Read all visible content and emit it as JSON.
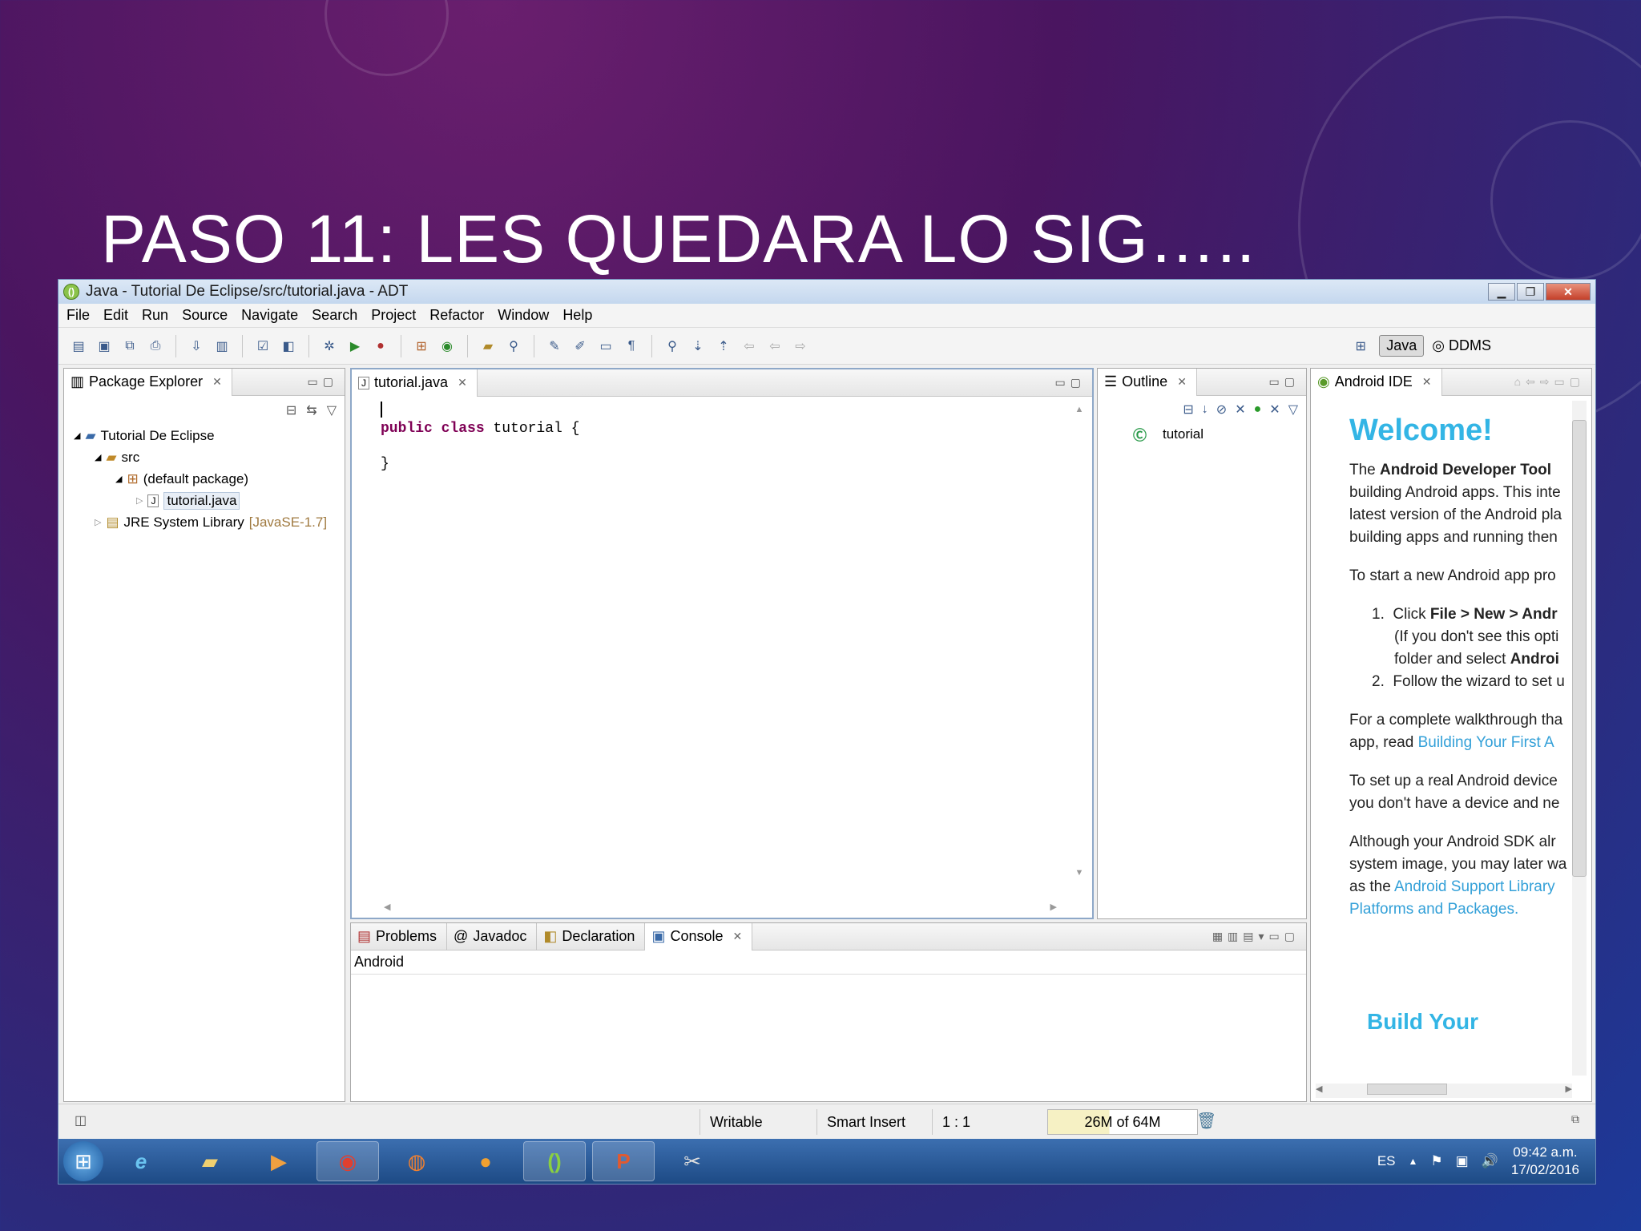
{
  "slide": {
    "title": "PASO 11: LES QUEDARA LO SIG….."
  },
  "window": {
    "title": "Java - Tutorial De Eclipse/src/tutorial.java - ADT",
    "menu": [
      "File",
      "Edit",
      "Run",
      "Source",
      "Navigate",
      "Search",
      "Project",
      "Refactor",
      "Window",
      "Help"
    ],
    "perspectives": {
      "java": "Java",
      "ddms": "DDMS"
    }
  },
  "package_explorer": {
    "tab": "Package Explorer",
    "tree": {
      "project": "Tutorial De Eclipse",
      "src": "src",
      "package": "(default package)",
      "file": "tutorial.java",
      "jre": "JRE System Library",
      "jre_version": "[JavaSE-1.7]"
    }
  },
  "editor": {
    "tab": "tutorial.java",
    "line1_kw": "public class",
    "line1_rest": " tutorial {",
    "line2": "}"
  },
  "outline": {
    "tab": "Outline",
    "item": "tutorial"
  },
  "android_ide": {
    "tab": "Android IDE",
    "welcome": "Welcome!",
    "p1_a": "The ",
    "p1_b": "Android Developer Tool",
    "p1_l2": "building Android apps. This inte",
    "p1_l3": "latest version of the Android pla",
    "p1_l4": "building apps and running then",
    "p2": "To start a new Android app pro",
    "s1_num": "1.",
    "s1_a": "Click ",
    "s1_b": "File > New > Andr",
    "s1_l2": "(If you don't see this opti",
    "s1_l3_a": "folder and select ",
    "s1_l3_b": "Androi",
    "s2_num": "2.",
    "s2": "Follow the wizard to set u",
    "p3_l1": "For a complete walkthrough tha",
    "p3_l2_a": "app, read ",
    "p3_l2_link": "Building Your First A",
    "p4_l1": "To set up a real Android device",
    "p4_l2": "you don't have a device and ne",
    "p5_l1": "Although your Android SDK alr",
    "p5_l2": "system image, you may later wa",
    "p5_l3_a": "as the ",
    "p5_l3_link": "Android Support Library",
    "p5_l4_link": "Platforms and Packages.",
    "subheading": "Build Your"
  },
  "bottom_panel": {
    "tabs": [
      "Problems",
      "Javadoc",
      "Declaration",
      "Console"
    ],
    "console_label": "Android"
  },
  "status": {
    "writable": "Writable",
    "insert_mode": "Smart Insert",
    "position": "1 : 1",
    "heap": "26M of 64M"
  },
  "taskbar": {
    "lang": "ES",
    "time": "09:42 a.m.",
    "date": "17/02/2016"
  }
}
